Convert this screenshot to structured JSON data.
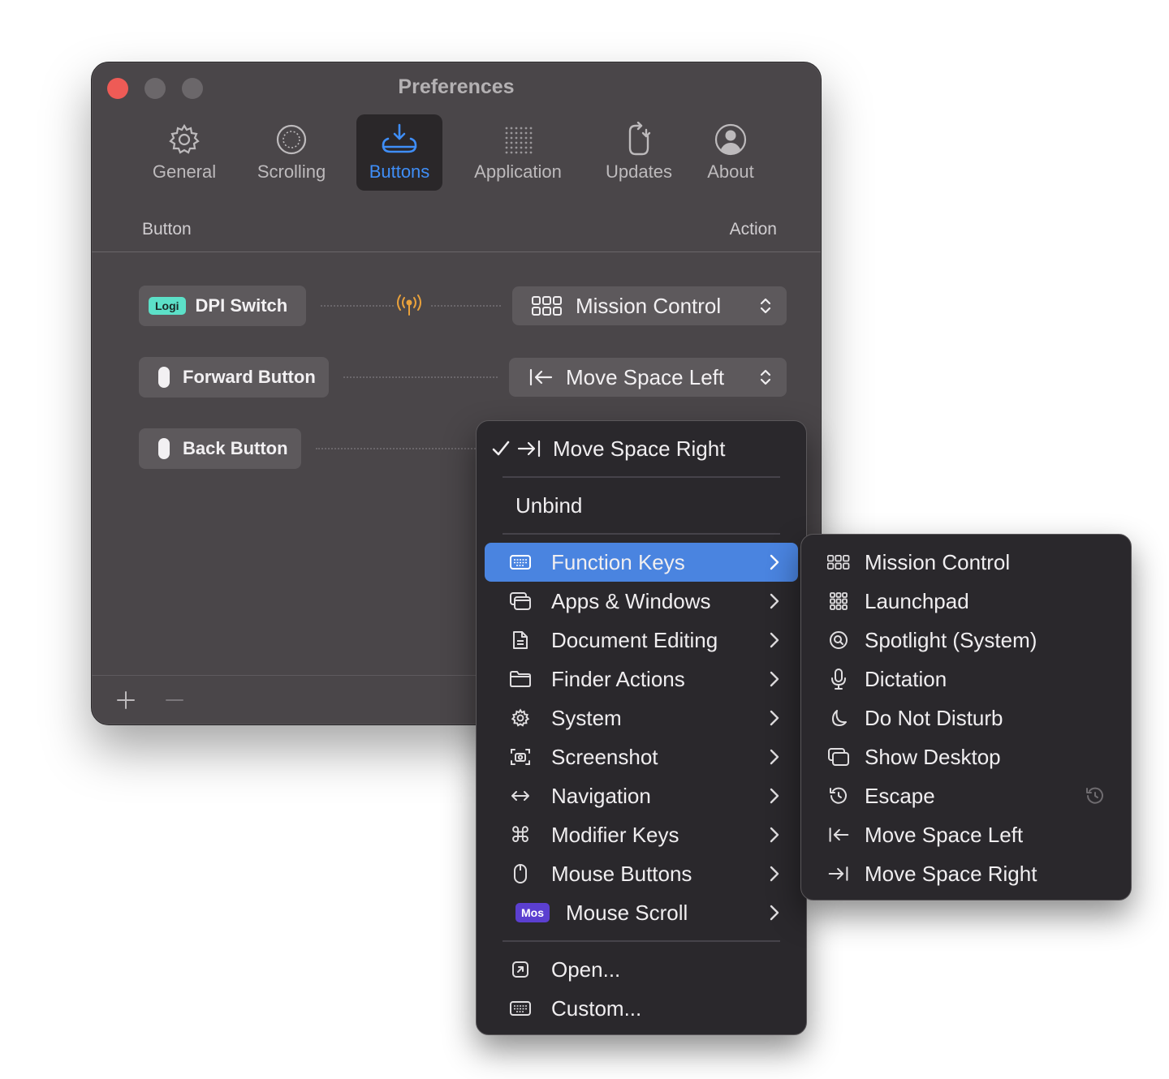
{
  "window": {
    "title": "Preferences"
  },
  "tabs": [
    {
      "label": "General",
      "icon": "gear-icon"
    },
    {
      "label": "Scrolling",
      "icon": "scroll-icon"
    },
    {
      "label": "Buttons",
      "icon": "buttons-icon"
    },
    {
      "label": "Application",
      "icon": "application-icon"
    },
    {
      "label": "Updates",
      "icon": "updates-icon"
    },
    {
      "label": "About",
      "icon": "person-icon"
    }
  ],
  "active_tab": "Buttons",
  "columns": {
    "button": "Button",
    "action": "Action"
  },
  "bindings": [
    {
      "badge": "Logi",
      "button": "DPI Switch",
      "action": "Mission Control"
    },
    {
      "button": "Forward Button",
      "action": "Move Space Left"
    },
    {
      "button": "Back Button",
      "action": "Move Space Right"
    }
  ],
  "menu": {
    "selected": "Move Space Right",
    "unbind": "Unbind",
    "categories": [
      {
        "label": "Function Keys",
        "icon": "keyboard-icon"
      },
      {
        "label": "Apps & Windows",
        "icon": "windows-icon"
      },
      {
        "label": "Document Editing",
        "icon": "document-icon"
      },
      {
        "label": "Finder Actions",
        "icon": "folder-icon"
      },
      {
        "label": "System",
        "icon": "gear-icon"
      },
      {
        "label": "Screenshot",
        "icon": "screenshot-icon"
      },
      {
        "label": "Navigation",
        "icon": "arrows-icon"
      },
      {
        "label": "Modifier Keys",
        "icon": "command-icon"
      },
      {
        "label": "Mouse Buttons",
        "icon": "mouse-icon"
      },
      {
        "label": "Mouse Scroll",
        "icon": "mos-badge",
        "badge": "Mos"
      }
    ],
    "open": "Open...",
    "custom": "Custom..."
  },
  "submenu": {
    "items": [
      {
        "label": "Mission Control",
        "icon": "grid-icon"
      },
      {
        "label": "Launchpad",
        "icon": "launchpad-icon"
      },
      {
        "label": "Spotlight (System)",
        "icon": "spotlight-icon"
      },
      {
        "label": "Dictation",
        "icon": "mic-icon"
      },
      {
        "label": "Do Not Disturb",
        "icon": "moon-icon"
      },
      {
        "label": "Show Desktop",
        "icon": "desktop-icon"
      },
      {
        "label": "Escape",
        "icon": "escape-icon"
      },
      {
        "label": "Move Space Left",
        "icon": "arrow-left-bar-icon"
      },
      {
        "label": "Move Space Right",
        "icon": "arrow-right-bar-icon"
      }
    ]
  },
  "colors": {
    "accent": "#3f8ef7",
    "highlight": "#4a84e0",
    "logi": "#5ce0c8",
    "mos": "#5b3fd0",
    "signal": "#e9a13b"
  }
}
